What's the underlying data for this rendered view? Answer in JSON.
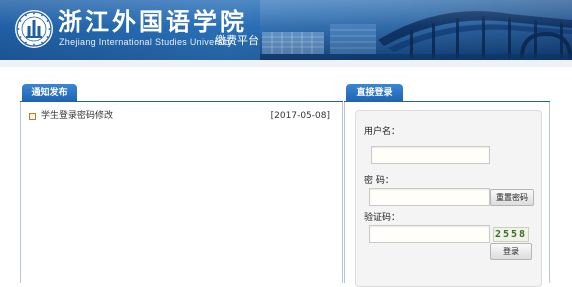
{
  "header": {
    "university_name": "浙江外国语学院",
    "university_name_en": "Zhejiang International Studies University",
    "platform": "缴费平台"
  },
  "notice": {
    "tab": "通知发布",
    "items": [
      {
        "title": "学生登录密码修改",
        "date": "[2017-05-08]"
      }
    ]
  },
  "login": {
    "tab": "直接登录",
    "username_label": "用户名：",
    "username_value": "",
    "password_label": "密 码：",
    "password_value": "",
    "reset_password_button": "重置密码",
    "captcha_label": "验证码：",
    "captcha_value": "",
    "captcha_text": "2558",
    "login_button": "登录"
  },
  "colors": {
    "header_blue": "#1f5fa5",
    "tab_blue": "#1d63b0"
  }
}
